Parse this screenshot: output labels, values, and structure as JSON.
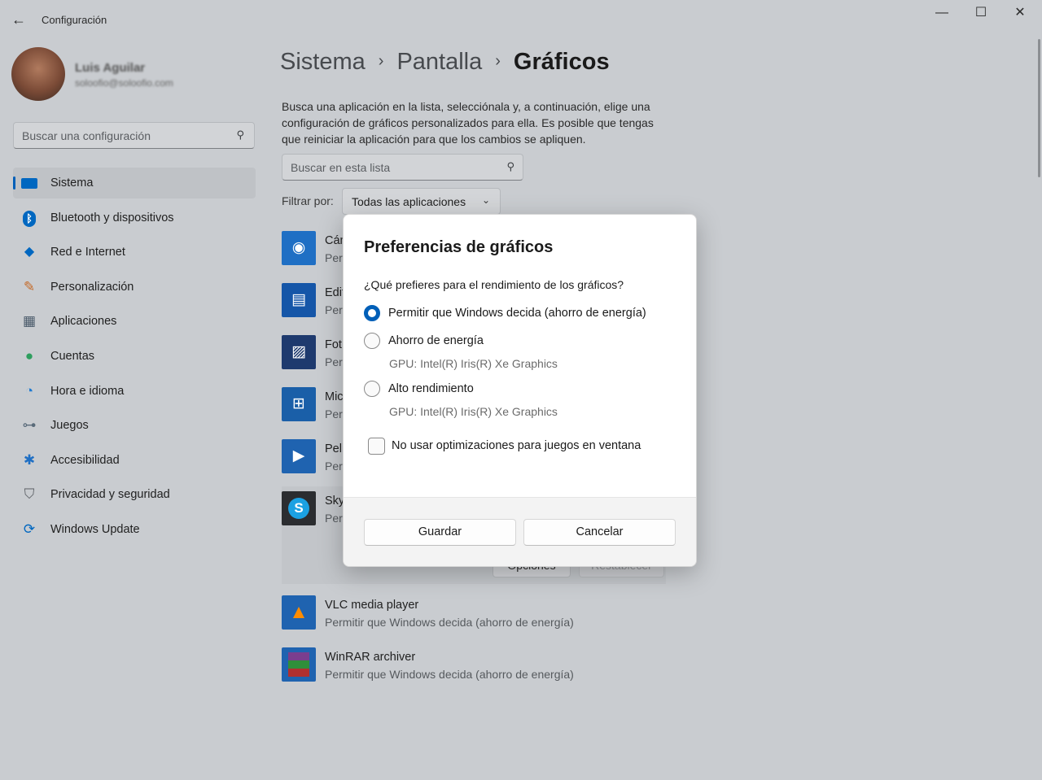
{
  "window": {
    "app_title": "Configuración",
    "controls": {
      "minimize": "—",
      "maximize": "☐",
      "close": "✕"
    }
  },
  "user": {
    "name": "Luis Aguilar",
    "email": "soloofio@soloofio.com"
  },
  "sidebar": {
    "search_placeholder": "Buscar una configuración",
    "items": [
      {
        "label": "Sistema",
        "icon": "monitor-icon",
        "color": "#0067c0"
      },
      {
        "label": "Bluetooth y dispositivos",
        "icon": "bluetooth-icon",
        "color": "#0067c0"
      },
      {
        "label": "Red e Internet",
        "icon": "wifi-icon",
        "color": "#0067c0"
      },
      {
        "label": "Personalización",
        "icon": "brush-icon",
        "color": "#c56a28"
      },
      {
        "label": "Aplicaciones",
        "icon": "apps-icon",
        "color": "#4a5a6a"
      },
      {
        "label": "Cuentas",
        "icon": "person-icon",
        "color": "#2e9e5e"
      },
      {
        "label": "Hora e idioma",
        "icon": "globe-clock-icon",
        "color": "#1f7bd1"
      },
      {
        "label": "Juegos",
        "icon": "gamepad-icon",
        "color": "#5a6b7a"
      },
      {
        "label": "Accesibilidad",
        "icon": "accessibility-icon",
        "color": "#1f6fc4"
      },
      {
        "label": "Privacidad y seguridad",
        "icon": "shield-icon",
        "color": "#5a5e64"
      },
      {
        "label": "Windows Update",
        "icon": "update-icon",
        "color": "#0067c0"
      }
    ]
  },
  "breadcrumb": {
    "part1": "Sistema",
    "part2": "Pantalla",
    "current": "Gráficos",
    "sep": "›"
  },
  "main": {
    "description": "Busca una aplicación en la lista, selecciónala y, a continuación, elige una configuración de gráficos personalizados para ella. Es posible que tengas que reiniciar la aplicación para que los cambios se apliquen.",
    "search_placeholder": "Buscar en esta lista",
    "filter_label": "Filtrar por:",
    "filter_value": "Todas las aplicaciones",
    "apps": [
      {
        "name": "Cám",
        "sub": "Per",
        "color": "#1f6fc4",
        "icon": "camera-icon"
      },
      {
        "name": "Edit",
        "sub": "Per",
        "color": "#1556a8",
        "icon": "video-editor-icon"
      },
      {
        "name": "Fot",
        "sub": "Per",
        "color": "#1e3a6e",
        "icon": "photos-icon"
      },
      {
        "name": "Mic",
        "sub": "Per",
        "color": "#1a5fa8",
        "icon": "store-icon"
      },
      {
        "name": "Peli",
        "sub": "Per",
        "color": "#1f63b0",
        "icon": "movies-icon"
      },
      {
        "name": "Sky",
        "sub": "Per",
        "color": "#2b2d30",
        "icon": "skype-icon"
      },
      {
        "name": "VLC media player",
        "sub": "Permitir que Windows decida (ahorro de energía)",
        "color": "#e68a00",
        "icon": "vlc-icon"
      },
      {
        "name": "WinRAR archiver",
        "sub": "Permitir que Windows decida (ahorro de energía)",
        "color": "#7a3e8e",
        "icon": "winrar-icon"
      }
    ],
    "hidden_buttons": {
      "options": "Opciones",
      "reset": "Restablecer"
    }
  },
  "dialog": {
    "title": "Preferencias de gráficos",
    "question": "¿Qué prefieres para el rendimiento de los gráficos?",
    "options": [
      {
        "label": "Permitir que Windows decida (ahorro de energía)",
        "sub": "",
        "checked": true
      },
      {
        "label": "Ahorro de energía",
        "sub": "GPU: Intel(R) Iris(R) Xe Graphics",
        "checked": false
      },
      {
        "label": "Alto rendimiento",
        "sub": "GPU: Intel(R) Iris(R) Xe Graphics",
        "checked": false
      }
    ],
    "checkbox_label": "No usar optimizaciones para juegos en ventana",
    "checkbox_checked": false,
    "save_label": "Guardar",
    "cancel_label": "Cancelar",
    "accent_color": "#005fb8"
  }
}
